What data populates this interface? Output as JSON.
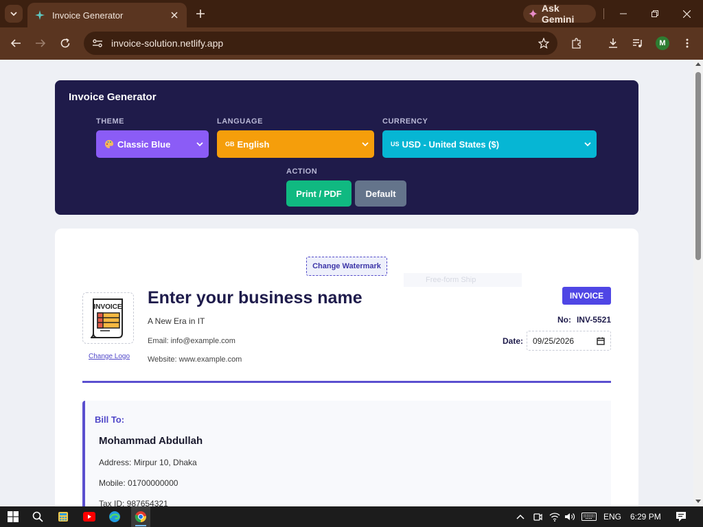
{
  "browser": {
    "tab_title": "Invoice Generator",
    "url": "invoice-solution.netlify.app",
    "gemini_label": "Ask Gemini",
    "profile_initial": "M"
  },
  "app": {
    "title": "Invoice Generator",
    "theme": {
      "label": "THEME",
      "value": "Classic Blue",
      "color": "#8b5cf6"
    },
    "language": {
      "label": "LANGUAGE",
      "flag": "GB",
      "value": "English",
      "color": "#f59e0b"
    },
    "currency": {
      "label": "CURRENCY",
      "flag": "US",
      "value": "USD - United States ($)",
      "color": "#06b6d4"
    },
    "action": {
      "label": "ACTION",
      "print_label": "Print / PDF",
      "default_label": "Default"
    }
  },
  "invoice": {
    "watermark_button": "Change Watermark",
    "watermark_placeholder": "Free-form Ship",
    "change_logo": "Change Logo",
    "logo_text": "INVOICE",
    "business_name": "Enter your business name",
    "tagline": "A New Era in IT",
    "email": "Email: info@example.com",
    "website": "Website: www.example.com",
    "badge": "INVOICE",
    "number_label": "No:",
    "number": "INV-5521",
    "date_label": "Date:",
    "date": "09/25/2026",
    "bill_to": {
      "title": "Bill To:",
      "name": "Mohammad Abdullah",
      "address": "Address: Mirpur 10, Dhaka",
      "mobile": "Mobile: 01700000000",
      "tax_id": "Tax ID: 987654321"
    }
  },
  "taskbar": {
    "language": "ENG",
    "time": "6:29 PM"
  }
}
